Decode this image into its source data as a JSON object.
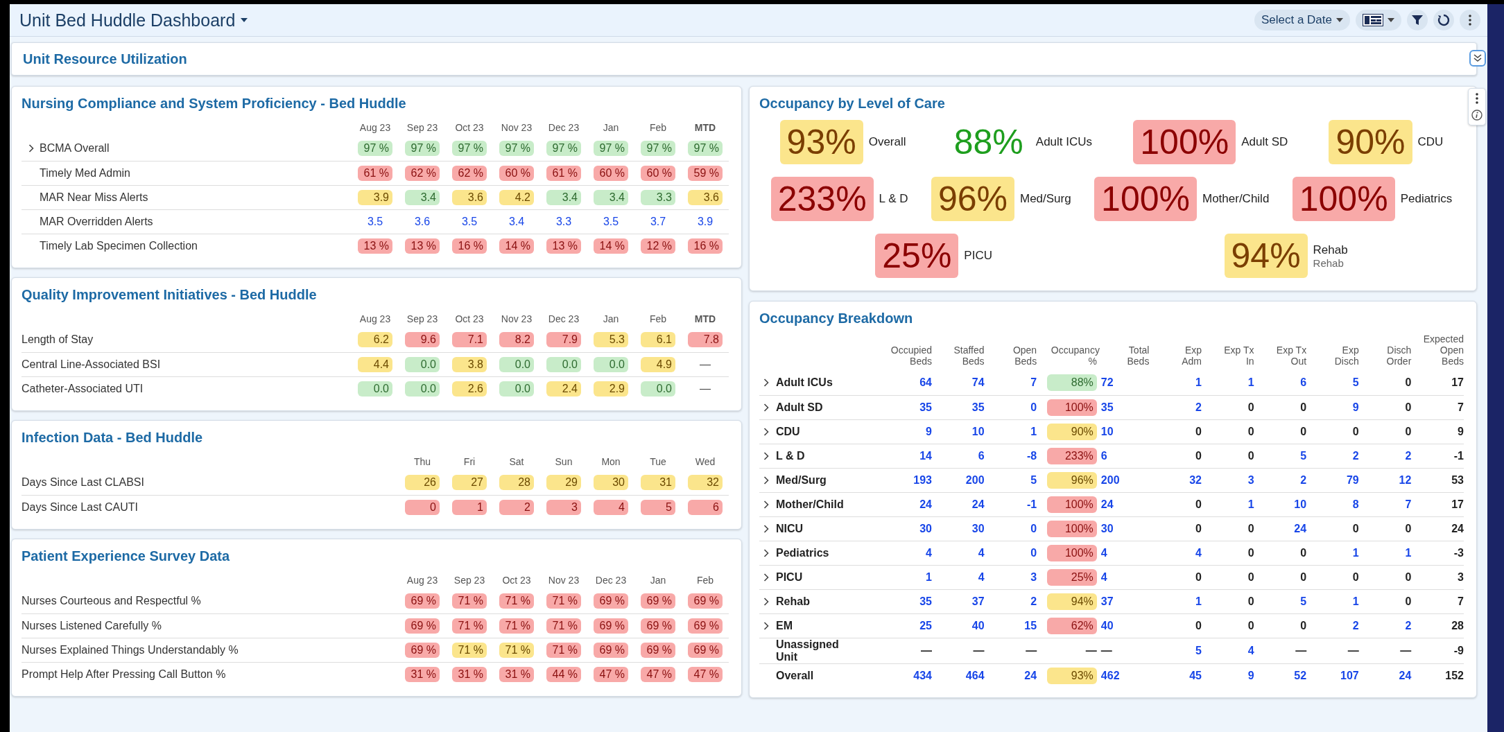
{
  "header": {
    "title": "Unit Bed Huddle Dashboard",
    "date_button": "Select a Date"
  },
  "section": {
    "title": "Unit Resource Utilization"
  },
  "left_panels": [
    {
      "title": "Nursing Compliance and System Proficiency - Bed Huddle",
      "columns": [
        {
          "label": "Aug 23",
          "bold": false
        },
        {
          "label": "Sep 23",
          "bold": false
        },
        {
          "label": "Oct 23",
          "bold": false
        },
        {
          "label": "Nov 23",
          "bold": false
        },
        {
          "label": "Dec 23",
          "bold": false
        },
        {
          "label": "Jan",
          "bold": false
        },
        {
          "label": "Feb",
          "bold": false
        },
        {
          "label": "MTD",
          "bold": true
        }
      ],
      "rows": [
        {
          "label": "BCMA Overall",
          "expandable": true,
          "cells": [
            {
              "text": "97 %",
              "kind": "badge",
              "color": "#c8ecc9"
            },
            {
              "text": "97 %",
              "kind": "badge",
              "color": "#c8ecc9"
            },
            {
              "text": "97 %",
              "kind": "badge",
              "color": "#c8ecc9"
            },
            {
              "text": "97 %",
              "kind": "badge",
              "color": "#c8ecc9"
            },
            {
              "text": "97 %",
              "kind": "badge",
              "color": "#c8ecc9"
            },
            {
              "text": "97 %",
              "kind": "badge",
              "color": "#c8ecc9"
            },
            {
              "text": "97 %",
              "kind": "badge",
              "color": "#c8ecc9"
            },
            {
              "text": "97 %",
              "kind": "badge",
              "color": "#c8ecc9"
            }
          ]
        },
        {
          "label": "Timely Med Admin",
          "expandable": false,
          "cells": [
            {
              "text": "61 %",
              "kind": "badge",
              "color": "#f8a9a8"
            },
            {
              "text": "62 %",
              "kind": "badge",
              "color": "#f8a9a8"
            },
            {
              "text": "62 %",
              "kind": "badge",
              "color": "#f8a9a8"
            },
            {
              "text": "60 %",
              "kind": "badge",
              "color": "#f8a9a8"
            },
            {
              "text": "61 %",
              "kind": "badge",
              "color": "#f8a9a8"
            },
            {
              "text": "60 %",
              "kind": "badge",
              "color": "#f8a9a8"
            },
            {
              "text": "60 %",
              "kind": "badge",
              "color": "#f8a9a8"
            },
            {
              "text": "59 %",
              "kind": "badge",
              "color": "#f8a9a8"
            }
          ]
        },
        {
          "label": "MAR Near Miss Alerts",
          "expandable": false,
          "cells": [
            {
              "text": "3.9",
              "kind": "badge",
              "color": "#fbe58c"
            },
            {
              "text": "3.4",
              "kind": "badge",
              "color": "#c8ecc9"
            },
            {
              "text": "3.6",
              "kind": "badge",
              "color": "#fbe58c"
            },
            {
              "text": "4.2",
              "kind": "badge",
              "color": "#fbe58c"
            },
            {
              "text": "3.4",
              "kind": "badge",
              "color": "#c8ecc9"
            },
            {
              "text": "3.4",
              "kind": "badge",
              "color": "#c8ecc9"
            },
            {
              "text": "3.3",
              "kind": "badge",
              "color": "#c8ecc9"
            },
            {
              "text": "3.6",
              "kind": "badge",
              "color": "#fbe58c"
            }
          ]
        },
        {
          "label": "MAR Overridden Alerts",
          "expandable": false,
          "cells": [
            {
              "text": "3.5",
              "kind": "link"
            },
            {
              "text": "3.6",
              "kind": "link"
            },
            {
              "text": "3.5",
              "kind": "link"
            },
            {
              "text": "3.4",
              "kind": "link"
            },
            {
              "text": "3.3",
              "kind": "link"
            },
            {
              "text": "3.5",
              "kind": "link"
            },
            {
              "text": "3.7",
              "kind": "link"
            },
            {
              "text": "3.9",
              "kind": "link"
            }
          ]
        },
        {
          "label": "Timely Lab Specimen Collection",
          "expandable": false,
          "cells": [
            {
              "text": "13 %",
              "kind": "badge",
              "color": "#f8a9a8"
            },
            {
              "text": "13 %",
              "kind": "badge",
              "color": "#f8a9a8"
            },
            {
              "text": "16 %",
              "kind": "badge",
              "color": "#f8a9a8"
            },
            {
              "text": "14 %",
              "kind": "badge",
              "color": "#f8a9a8"
            },
            {
              "text": "13 %",
              "kind": "badge",
              "color": "#f8a9a8"
            },
            {
              "text": "14 %",
              "kind": "badge",
              "color": "#f8a9a8"
            },
            {
              "text": "12 %",
              "kind": "badge",
              "color": "#f8a9a8"
            },
            {
              "text": "16 %",
              "kind": "badge",
              "color": "#f8a9a8"
            }
          ]
        }
      ]
    },
    {
      "title": "Quality Improvement Initiatives - Bed Huddle",
      "columns": [
        {
          "label": "Aug 23",
          "bold": false
        },
        {
          "label": "Sep 23",
          "bold": false
        },
        {
          "label": "Oct 23",
          "bold": false
        },
        {
          "label": "Nov 23",
          "bold": false
        },
        {
          "label": "Dec 23",
          "bold": false
        },
        {
          "label": "Jan",
          "bold": false
        },
        {
          "label": "Feb",
          "bold": false
        },
        {
          "label": "MTD",
          "bold": true
        }
      ],
      "rows": [
        {
          "label": "Length of Stay",
          "expandable": false,
          "cells": [
            {
              "text": "6.2",
              "kind": "badge",
              "color": "#fbe58c"
            },
            {
              "text": "9.6",
              "kind": "badge",
              "color": "#f8a9a8"
            },
            {
              "text": "7.1",
              "kind": "badge",
              "color": "#f8a9a8"
            },
            {
              "text": "8.2",
              "kind": "badge",
              "color": "#f8a9a8"
            },
            {
              "text": "7.9",
              "kind": "badge",
              "color": "#f8a9a8"
            },
            {
              "text": "5.3",
              "kind": "badge",
              "color": "#fbe58c"
            },
            {
              "text": "6.1",
              "kind": "badge",
              "color": "#fbe58c"
            },
            {
              "text": "7.8",
              "kind": "badge",
              "color": "#f8a9a8"
            }
          ]
        },
        {
          "label": "Central Line-Associated BSI",
          "expandable": false,
          "cells": [
            {
              "text": "4.4",
              "kind": "badge",
              "color": "#fbe58c"
            },
            {
              "text": "0.0",
              "kind": "badge",
              "color": "#c8ecc9"
            },
            {
              "text": "3.8",
              "kind": "badge",
              "color": "#fbe58c"
            },
            {
              "text": "0.0",
              "kind": "badge",
              "color": "#c8ecc9"
            },
            {
              "text": "0.0",
              "kind": "badge",
              "color": "#c8ecc9"
            },
            {
              "text": "0.0",
              "kind": "badge",
              "color": "#c8ecc9"
            },
            {
              "text": "4.9",
              "kind": "badge",
              "color": "#fbe58c"
            },
            {
              "text": "—",
              "kind": "plain"
            }
          ]
        },
        {
          "label": "Catheter-Associated UTI",
          "expandable": false,
          "cells": [
            {
              "text": "0.0",
              "kind": "badge",
              "color": "#c8ecc9"
            },
            {
              "text": "0.0",
              "kind": "badge",
              "color": "#c8ecc9"
            },
            {
              "text": "2.6",
              "kind": "badge",
              "color": "#fbe58c"
            },
            {
              "text": "0.0",
              "kind": "badge",
              "color": "#c8ecc9"
            },
            {
              "text": "2.4",
              "kind": "badge",
              "color": "#fbe58c"
            },
            {
              "text": "2.9",
              "kind": "badge",
              "color": "#fbe58c"
            },
            {
              "text": "0.0",
              "kind": "badge",
              "color": "#c8ecc9"
            },
            {
              "text": "—",
              "kind": "plain"
            }
          ]
        }
      ]
    },
    {
      "title": "Infection Data - Bed Huddle",
      "columns": [
        {
          "label": "Thu",
          "bold": false
        },
        {
          "label": "Fri",
          "bold": false
        },
        {
          "label": "Sat",
          "bold": false
        },
        {
          "label": "Sun",
          "bold": false
        },
        {
          "label": "Mon",
          "bold": false
        },
        {
          "label": "Tue",
          "bold": false
        },
        {
          "label": "Wed",
          "bold": false
        }
      ],
      "rows": [
        {
          "label": "Days Since Last CLABSI",
          "expandable": false,
          "cells": [
            {
              "text": "26",
              "kind": "badge",
              "color": "#fbe58c"
            },
            {
              "text": "27",
              "kind": "badge",
              "color": "#fbe58c"
            },
            {
              "text": "28",
              "kind": "badge",
              "color": "#fbe58c"
            },
            {
              "text": "29",
              "kind": "badge",
              "color": "#fbe58c"
            },
            {
              "text": "30",
              "kind": "badge",
              "color": "#fbe58c"
            },
            {
              "text": "31",
              "kind": "badge",
              "color": "#fbe58c"
            },
            {
              "text": "32",
              "kind": "badge",
              "color": "#fbe58c"
            }
          ]
        },
        {
          "label": "Days Since Last CAUTI",
          "expandable": false,
          "cells": [
            {
              "text": "0",
              "kind": "badge",
              "color": "#f8a9a8"
            },
            {
              "text": "1",
              "kind": "badge",
              "color": "#f8a9a8"
            },
            {
              "text": "2",
              "kind": "badge",
              "color": "#f8a9a8"
            },
            {
              "text": "3",
              "kind": "badge",
              "color": "#f8a9a8"
            },
            {
              "text": "4",
              "kind": "badge",
              "color": "#f8a9a8"
            },
            {
              "text": "5",
              "kind": "badge",
              "color": "#f8a9a8"
            },
            {
              "text": "6",
              "kind": "badge",
              "color": "#f8a9a8"
            }
          ]
        }
      ]
    },
    {
      "title": "Patient Experience Survey Data",
      "columns": [
        {
          "label": "Aug 23",
          "bold": false
        },
        {
          "label": "Sep 23",
          "bold": false
        },
        {
          "label": "Oct 23",
          "bold": false
        },
        {
          "label": "Nov 23",
          "bold": false
        },
        {
          "label": "Dec 23",
          "bold": false
        },
        {
          "label": "Jan",
          "bold": false
        },
        {
          "label": "Feb",
          "bold": false
        }
      ],
      "rows": [
        {
          "label": "Nurses Courteous and Respectful %",
          "expandable": false,
          "cells": [
            {
              "text": "69 %",
              "kind": "badge",
              "color": "#f8a9a8"
            },
            {
              "text": "71 %",
              "kind": "badge",
              "color": "#f8a9a8"
            },
            {
              "text": "71 %",
              "kind": "badge",
              "color": "#f8a9a8"
            },
            {
              "text": "71 %",
              "kind": "badge",
              "color": "#f8a9a8"
            },
            {
              "text": "69 %",
              "kind": "badge",
              "color": "#f8a9a8"
            },
            {
              "text": "69 %",
              "kind": "badge",
              "color": "#f8a9a8"
            },
            {
              "text": "69 %",
              "kind": "badge",
              "color": "#f8a9a8"
            }
          ]
        },
        {
          "label": "Nurses Listened Carefully %",
          "expandable": false,
          "cells": [
            {
              "text": "69 %",
              "kind": "badge",
              "color": "#f8a9a8"
            },
            {
              "text": "71 %",
              "kind": "badge",
              "color": "#f8a9a8"
            },
            {
              "text": "71 %",
              "kind": "badge",
              "color": "#f8a9a8"
            },
            {
              "text": "71 %",
              "kind": "badge",
              "color": "#f8a9a8"
            },
            {
              "text": "69 %",
              "kind": "badge",
              "color": "#f8a9a8"
            },
            {
              "text": "69 %",
              "kind": "badge",
              "color": "#f8a9a8"
            },
            {
              "text": "69 %",
              "kind": "badge",
              "color": "#f8a9a8"
            }
          ]
        },
        {
          "label": "Nurses Explained Things Understandably %",
          "expandable": false,
          "cells": [
            {
              "text": "69 %",
              "kind": "badge",
              "color": "#f8a9a8"
            },
            {
              "text": "71 %",
              "kind": "badge",
              "color": "#fbe58c"
            },
            {
              "text": "71 %",
              "kind": "badge",
              "color": "#fbe58c"
            },
            {
              "text": "71 %",
              "kind": "badge",
              "color": "#f8a9a8"
            },
            {
              "text": "69 %",
              "kind": "badge",
              "color": "#f8a9a8"
            },
            {
              "text": "69 %",
              "kind": "badge",
              "color": "#f8a9a8"
            },
            {
              "text": "69 %",
              "kind": "badge",
              "color": "#f8a9a8"
            }
          ]
        },
        {
          "label": "Prompt Help After Pressing Call Button %",
          "expandable": false,
          "cells": [
            {
              "text": "31 %",
              "kind": "badge",
              "color": "#f8a9a8"
            },
            {
              "text": "31 %",
              "kind": "badge",
              "color": "#f8a9a8"
            },
            {
              "text": "31 %",
              "kind": "badge",
              "color": "#f8a9a8"
            },
            {
              "text": "44 %",
              "kind": "badge",
              "color": "#f8a9a8"
            },
            {
              "text": "47 %",
              "kind": "badge",
              "color": "#f8a9a8"
            },
            {
              "text": "47 %",
              "kind": "badge",
              "color": "#f8a9a8"
            },
            {
              "text": "47 %",
              "kind": "badge",
              "color": "#f8a9a8"
            }
          ]
        }
      ]
    }
  ],
  "occupancy_by_level": {
    "title": "Occupancy by Level of Care",
    "rows": [
      {
        "tiles": [
          {
            "value": "93%",
            "label": "Overall",
            "kind": "badge",
            "color": "#fbe58c"
          },
          {
            "value": "88%",
            "label": "Adult ICUs",
            "kind": "text",
            "color": "#1e9e1e"
          },
          {
            "value": "100%",
            "label": "Adult SD",
            "kind": "badge",
            "color": "#f8a9a8"
          },
          {
            "value": "90%",
            "label": "CDU",
            "kind": "badge",
            "color": "#fbe58c"
          }
        ]
      },
      {
        "tiles": [
          {
            "value": "233%",
            "label": "L & D",
            "kind": "badge",
            "color": "#f8a9a8"
          },
          {
            "value": "96%",
            "label": "Med/Surg",
            "kind": "badge",
            "color": "#fbe58c"
          },
          {
            "value": "100%",
            "label": "Mother/Child",
            "kind": "badge",
            "color": "#f8a9a8"
          },
          {
            "value": "100%",
            "label": "Pediatrics",
            "kind": "badge",
            "color": "#f8a9a8"
          }
        ]
      },
      {
        "tiles": [
          {
            "value": "25%",
            "label": "PICU",
            "kind": "badge",
            "color": "#f8a9a8"
          },
          {
            "value": "94%",
            "label": "Rehab",
            "sublabel": "Rehab",
            "kind": "badge",
            "color": "#fbe58c"
          }
        ]
      }
    ]
  },
  "occupancy_breakdown": {
    "title": "Occupancy Breakdown",
    "columns": [
      "Occupied Beds",
      "Staffed Beds",
      "Open Beds",
      "Occupancy %",
      "Total Beds",
      "Exp Adm",
      "Exp Tx In",
      "Exp Tx Out",
      "Exp Disch",
      "Disch Order",
      "Expected Open Beds"
    ],
    "rows": [
      {
        "label": "Adult ICUs",
        "expandable": true,
        "cells": [
          {
            "text": "64",
            "kind": "link"
          },
          {
            "text": "74",
            "kind": "link"
          },
          {
            "text": "7",
            "kind": "link"
          },
          {
            "text": "88%",
            "kind": "badge",
            "color": "#c8ecc9"
          },
          {
            "text": "72",
            "kind": "link"
          },
          {
            "text": "1",
            "kind": "link"
          },
          {
            "text": "1",
            "kind": "link"
          },
          {
            "text": "6",
            "kind": "link"
          },
          {
            "text": "5",
            "kind": "link"
          },
          {
            "text": "0",
            "kind": "plain"
          },
          {
            "text": "17",
            "kind": "plain"
          }
        ]
      },
      {
        "label": "Adult SD",
        "expandable": true,
        "cells": [
          {
            "text": "35",
            "kind": "link"
          },
          {
            "text": "35",
            "kind": "link"
          },
          {
            "text": "0",
            "kind": "link"
          },
          {
            "text": "100%",
            "kind": "badge",
            "color": "#f8a9a8"
          },
          {
            "text": "35",
            "kind": "link"
          },
          {
            "text": "2",
            "kind": "link"
          },
          {
            "text": "0",
            "kind": "plain"
          },
          {
            "text": "0",
            "kind": "plain"
          },
          {
            "text": "9",
            "kind": "link"
          },
          {
            "text": "0",
            "kind": "plain"
          },
          {
            "text": "7",
            "kind": "plain"
          }
        ]
      },
      {
        "label": "CDU",
        "expandable": true,
        "cells": [
          {
            "text": "9",
            "kind": "link"
          },
          {
            "text": "10",
            "kind": "link"
          },
          {
            "text": "1",
            "kind": "link"
          },
          {
            "text": "90%",
            "kind": "badge",
            "color": "#fbe58c"
          },
          {
            "text": "10",
            "kind": "link"
          },
          {
            "text": "0",
            "kind": "plain"
          },
          {
            "text": "0",
            "kind": "plain"
          },
          {
            "text": "0",
            "kind": "plain"
          },
          {
            "text": "0",
            "kind": "plain"
          },
          {
            "text": "0",
            "kind": "plain"
          },
          {
            "text": "9",
            "kind": "plain"
          }
        ]
      },
      {
        "label": "L & D",
        "expandable": true,
        "cells": [
          {
            "text": "14",
            "kind": "link"
          },
          {
            "text": "6",
            "kind": "link"
          },
          {
            "text": "-8",
            "kind": "link"
          },
          {
            "text": "233%",
            "kind": "badge",
            "color": "#f8a9a8"
          },
          {
            "text": "6",
            "kind": "link"
          },
          {
            "text": "0",
            "kind": "plain"
          },
          {
            "text": "0",
            "kind": "plain"
          },
          {
            "text": "5",
            "kind": "link"
          },
          {
            "text": "2",
            "kind": "link"
          },
          {
            "text": "2",
            "kind": "link"
          },
          {
            "text": "-1",
            "kind": "plain"
          }
        ]
      },
      {
        "label": "Med/Surg",
        "expandable": true,
        "cells": [
          {
            "text": "193",
            "kind": "link"
          },
          {
            "text": "200",
            "kind": "link"
          },
          {
            "text": "5",
            "kind": "link"
          },
          {
            "text": "96%",
            "kind": "badge",
            "color": "#fbe58c"
          },
          {
            "text": "200",
            "kind": "link"
          },
          {
            "text": "32",
            "kind": "link"
          },
          {
            "text": "3",
            "kind": "link"
          },
          {
            "text": "2",
            "kind": "link"
          },
          {
            "text": "79",
            "kind": "link"
          },
          {
            "text": "12",
            "kind": "link"
          },
          {
            "text": "53",
            "kind": "plain"
          }
        ]
      },
      {
        "label": "Mother/Child",
        "expandable": true,
        "cells": [
          {
            "text": "24",
            "kind": "link"
          },
          {
            "text": "24",
            "kind": "link"
          },
          {
            "text": "-1",
            "kind": "link"
          },
          {
            "text": "100%",
            "kind": "badge",
            "color": "#f8a9a8"
          },
          {
            "text": "24",
            "kind": "link"
          },
          {
            "text": "0",
            "kind": "plain"
          },
          {
            "text": "1",
            "kind": "link"
          },
          {
            "text": "10",
            "kind": "link"
          },
          {
            "text": "8",
            "kind": "link"
          },
          {
            "text": "7",
            "kind": "link"
          },
          {
            "text": "17",
            "kind": "plain"
          }
        ]
      },
      {
        "label": "NICU",
        "expandable": true,
        "cells": [
          {
            "text": "30",
            "kind": "link"
          },
          {
            "text": "30",
            "kind": "link"
          },
          {
            "text": "0",
            "kind": "link"
          },
          {
            "text": "100%",
            "kind": "badge",
            "color": "#f8a9a8"
          },
          {
            "text": "30",
            "kind": "link"
          },
          {
            "text": "0",
            "kind": "plain"
          },
          {
            "text": "0",
            "kind": "plain"
          },
          {
            "text": "24",
            "kind": "link"
          },
          {
            "text": "0",
            "kind": "plain"
          },
          {
            "text": "0",
            "kind": "plain"
          },
          {
            "text": "24",
            "kind": "plain"
          }
        ]
      },
      {
        "label": "Pediatrics",
        "expandable": true,
        "cells": [
          {
            "text": "4",
            "kind": "link"
          },
          {
            "text": "4",
            "kind": "link"
          },
          {
            "text": "0",
            "kind": "link"
          },
          {
            "text": "100%",
            "kind": "badge",
            "color": "#f8a9a8"
          },
          {
            "text": "4",
            "kind": "link"
          },
          {
            "text": "4",
            "kind": "link"
          },
          {
            "text": "0",
            "kind": "plain"
          },
          {
            "text": "0",
            "kind": "plain"
          },
          {
            "text": "1",
            "kind": "link"
          },
          {
            "text": "1",
            "kind": "link"
          },
          {
            "text": "-3",
            "kind": "plain"
          }
        ]
      },
      {
        "label": "PICU",
        "expandable": true,
        "cells": [
          {
            "text": "1",
            "kind": "link"
          },
          {
            "text": "4",
            "kind": "link"
          },
          {
            "text": "3",
            "kind": "link"
          },
          {
            "text": "25%",
            "kind": "badge",
            "color": "#f8a9a8"
          },
          {
            "text": "4",
            "kind": "link"
          },
          {
            "text": "0",
            "kind": "plain"
          },
          {
            "text": "0",
            "kind": "plain"
          },
          {
            "text": "0",
            "kind": "plain"
          },
          {
            "text": "0",
            "kind": "plain"
          },
          {
            "text": "0",
            "kind": "plain"
          },
          {
            "text": "3",
            "kind": "plain"
          }
        ]
      },
      {
        "label": "Rehab",
        "expandable": true,
        "cells": [
          {
            "text": "35",
            "kind": "link"
          },
          {
            "text": "37",
            "kind": "link"
          },
          {
            "text": "2",
            "kind": "link"
          },
          {
            "text": "94%",
            "kind": "badge",
            "color": "#fbe58c"
          },
          {
            "text": "37",
            "kind": "link"
          },
          {
            "text": "1",
            "kind": "link"
          },
          {
            "text": "0",
            "kind": "plain"
          },
          {
            "text": "5",
            "kind": "link"
          },
          {
            "text": "1",
            "kind": "link"
          },
          {
            "text": "0",
            "kind": "plain"
          },
          {
            "text": "7",
            "kind": "plain"
          }
        ]
      },
      {
        "label": "EM",
        "expandable": true,
        "cells": [
          {
            "text": "25",
            "kind": "link"
          },
          {
            "text": "40",
            "kind": "link"
          },
          {
            "text": "15",
            "kind": "link"
          },
          {
            "text": "62%",
            "kind": "badge",
            "color": "#f8a9a8"
          },
          {
            "text": "40",
            "kind": "link"
          },
          {
            "text": "0",
            "kind": "plain"
          },
          {
            "text": "0",
            "kind": "plain"
          },
          {
            "text": "0",
            "kind": "plain"
          },
          {
            "text": "2",
            "kind": "link"
          },
          {
            "text": "2",
            "kind": "link"
          },
          {
            "text": "28",
            "kind": "plain"
          }
        ]
      },
      {
        "label": "Unassigned Unit",
        "expandable": false,
        "cells": [
          {
            "text": "—",
            "kind": "plain"
          },
          {
            "text": "—",
            "kind": "plain"
          },
          {
            "text": "—",
            "kind": "plain"
          },
          {
            "text": "—",
            "kind": "plain"
          },
          {
            "text": "—",
            "kind": "plain"
          },
          {
            "text": "5",
            "kind": "link"
          },
          {
            "text": "4",
            "kind": "link"
          },
          {
            "text": "—",
            "kind": "plain"
          },
          {
            "text": "—",
            "kind": "plain"
          },
          {
            "text": "—",
            "kind": "plain"
          },
          {
            "text": "-9",
            "kind": "plain"
          }
        ]
      },
      {
        "label": "Overall",
        "expandable": false,
        "cells": [
          {
            "text": "434",
            "kind": "link"
          },
          {
            "text": "464",
            "kind": "link"
          },
          {
            "text": "24",
            "kind": "link"
          },
          {
            "text": "93%",
            "kind": "badge",
            "color": "#fbe58c"
          },
          {
            "text": "462",
            "kind": "link"
          },
          {
            "text": "45",
            "kind": "link"
          },
          {
            "text": "9",
            "kind": "link"
          },
          {
            "text": "52",
            "kind": "link"
          },
          {
            "text": "107",
            "kind": "link"
          },
          {
            "text": "24",
            "kind": "link"
          },
          {
            "text": "152",
            "kind": "plain"
          }
        ]
      }
    ]
  }
}
